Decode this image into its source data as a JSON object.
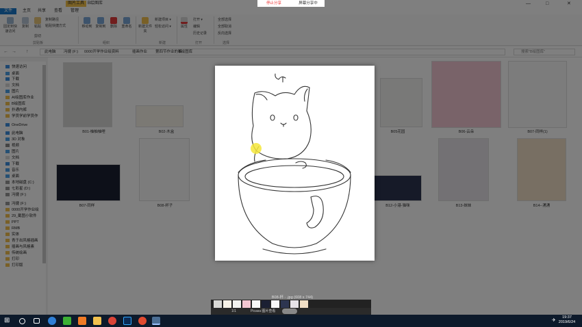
{
  "window": {
    "title_tab": "图片工具",
    "title": "B绘图库",
    "minimize": "—",
    "maximize": "□",
    "close": "✕"
  },
  "ribbon_tabs": {
    "file": "文件",
    "home": "主页",
    "share": "共享",
    "view": "查看",
    "manage": "管理"
  },
  "ribbon": {
    "pin": "固定到快速访问",
    "copy": "复制",
    "paste": "粘贴",
    "copy_path": "复制路径",
    "paste_shortcut": "粘贴快捷方式",
    "cut": "剪切",
    "move_to": "移动到",
    "copy_to": "复制到",
    "delete": "删除",
    "rename": "重命名",
    "new_folder": "新建文件夹",
    "new_item": "新建项目 ▾",
    "easy_access": "轻松访问 ▾",
    "properties": "属性",
    "open": "打开 ▾",
    "edit": "编辑",
    "history": "历史记录",
    "select_all": "全部选择",
    "select_none": "全部取消",
    "invert": "反向选择",
    "grp_clipboard": "剪贴板",
    "grp_organize": "组织",
    "grp_new": "新建",
    "grp_open": "打开",
    "grp_select": "选择"
  },
  "address": {
    "crumbs": [
      "此电脑",
      "冯捷 (F:)",
      "0000开学作业绘资料",
      "插画作业",
      "第四节作业的稿",
      "B绘图库"
    ],
    "search_placeholder": "搜索\"B绘图库\"",
    "back": "←",
    "forward": "→",
    "up": "↑"
  },
  "nav": [
    {
      "label": "快速访问",
      "color": "#3d8ee0"
    },
    {
      "label": "桌面",
      "color": "#4aa0e8"
    },
    {
      "label": "下载",
      "color": "#3d8ee0"
    },
    {
      "label": "文档",
      "color": "#d8d8d8"
    },
    {
      "label": "图片",
      "color": "#4aa0e8"
    },
    {
      "label": "AI绘图库作业",
      "color": "#f2c14e"
    },
    {
      "label": "B绘图库",
      "color": "#f2c14e"
    },
    {
      "label": "扑通内裤",
      "color": "#f2c14e"
    },
    {
      "label": "学员学前学员作",
      "color": "#f2c14e"
    },
    {
      "label": "OneDrive",
      "color": "#3d8ee0"
    },
    {
      "label": "此电脑",
      "color": "#3d8ee0"
    },
    {
      "label": "3D 对象",
      "color": "#4aa0e8"
    },
    {
      "label": "视频",
      "color": "#888"
    },
    {
      "label": "图片",
      "color": "#4aa0e8"
    },
    {
      "label": "文档",
      "color": "#d8d8d8"
    },
    {
      "label": "下载",
      "color": "#3d8ee0"
    },
    {
      "label": "音乐",
      "color": "#4aa0e8"
    },
    {
      "label": "桌面",
      "color": "#4aa0e8"
    },
    {
      "label": "本地磁盘 (C:)",
      "color": "#999"
    },
    {
      "label": "七彩星 (D:)",
      "color": "#999"
    },
    {
      "label": "冯捷 (F:)",
      "color": "#999"
    },
    {
      "label": "冯捷 (F:)",
      "color": "#999"
    },
    {
      "label": "0000开学作业绘",
      "color": "#f2c14e"
    },
    {
      "label": "29_截图小软件",
      "color": "#f2c14e"
    },
    {
      "label": "PPT",
      "color": "#f2c14e"
    },
    {
      "label": "RMB",
      "color": "#f2c14e"
    },
    {
      "label": "实体",
      "color": "#f2c14e"
    },
    {
      "label": "青于出风格插画",
      "color": "#f2c14e"
    },
    {
      "label": "插画与风格素",
      "color": "#f2c14e"
    },
    {
      "label": "传统绘画",
      "color": "#f2c14e"
    },
    {
      "label": "打印",
      "color": "#f2c14e"
    },
    {
      "label": "打印版",
      "color": "#f2c14e"
    }
  ],
  "files": [
    {
      "caption": "B01-柚柚柚哩",
      "color": "#d9d9d6"
    },
    {
      "caption": "B02-木盒",
      "color": "#f6f2e8"
    },
    {
      "caption": "B05花园",
      "color": "#f2f2f0"
    },
    {
      "caption": "B06-云朵",
      "color": "#f3c6d2"
    },
    {
      "caption": "B07-同样(1)",
      "color": "#f8f8f8"
    },
    {
      "caption": "B07-同样",
      "color": "#1b2033"
    },
    {
      "caption": "B08-杯子",
      "color": "#f8f8f8"
    },
    {
      "caption": "B12-小港-猫咪",
      "color": "#2d3550"
    },
    {
      "caption": "B13-妹妹",
      "color": "#e6e3e8"
    },
    {
      "caption": "B14--湧湧",
      "color": "#f0dfc6"
    }
  ],
  "overlay": {
    "stop_share": "停止分享",
    "screen_share": "屏幕分享中"
  },
  "viewer": {
    "info": "B08-杯 · .jpg (608 x 744)",
    "page": "1/1",
    "app": "Picasa 图片查看"
  },
  "taskbar": {
    "time": "19:37",
    "date": "2019/6/24"
  }
}
